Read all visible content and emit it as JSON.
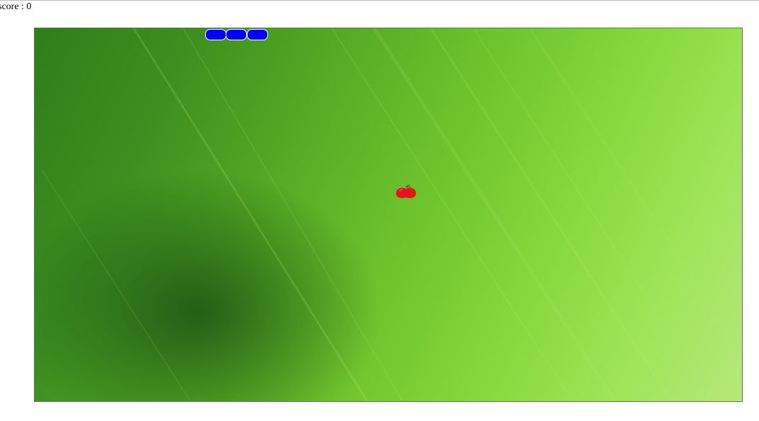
{
  "score": {
    "label": "score : 0",
    "value": 0
  },
  "board": {
    "background": "green-streak-wallpaper"
  },
  "snake": {
    "color": "#0000ff",
    "outline": "#ffffff",
    "segment_count": 3,
    "direction": "left"
  },
  "food": {
    "icon": "apple-icon",
    "color": "#e8121a"
  }
}
